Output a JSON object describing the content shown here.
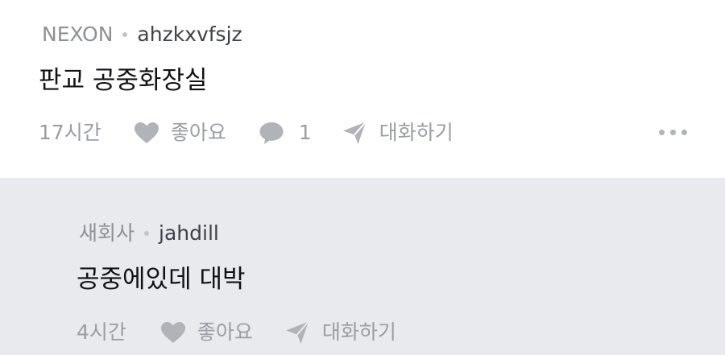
{
  "post": {
    "company": "NEXON",
    "username": "ahzkxvfsjz",
    "text": "판교 공중화장실",
    "time": "17시간",
    "like_label": "좋아요",
    "comment_count": "1",
    "chat_label": "대화하기"
  },
  "reply": {
    "company": "새회사",
    "username": "jahdill",
    "text": "공중에있데 대박",
    "time": "4시간",
    "like_label": "좋아요",
    "chat_label": "대화하기"
  },
  "colors": {
    "meta_gray": "#8d9096",
    "icon_gray": "#b0b3b8",
    "reply_bg": "#e9eaee"
  },
  "icons": [
    "heart-icon",
    "comment-bubble-icon",
    "send-icon",
    "more-icon"
  ]
}
